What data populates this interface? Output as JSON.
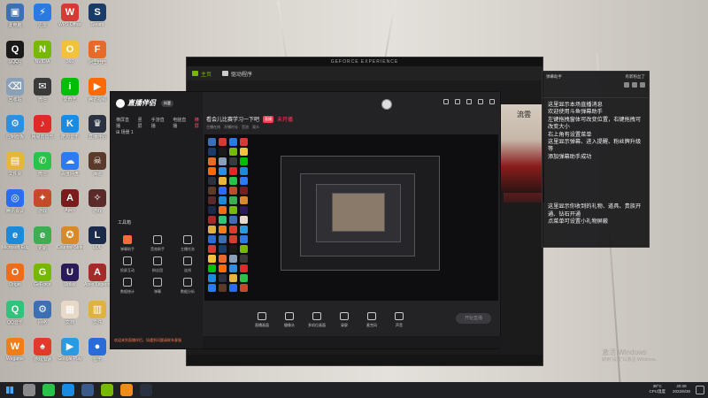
{
  "desktop": {
    "icons": [
      {
        "label": "此电脑",
        "glyph": "▣",
        "color": "#3d6fb3",
        "col": 0,
        "row": 0
      },
      {
        "label": "易语言",
        "glyph": "Y",
        "color": "#d53b2f",
        "col": 0,
        "row": 1
      },
      {
        "label": "迅雷",
        "glyph": "⚡",
        "color": "#2a7ae2",
        "col": 1,
        "row": 0
      },
      {
        "label": "WPS Office",
        "glyph": "W",
        "color": "#d43b34",
        "col": 2,
        "row": 0
      },
      {
        "label": "Steam",
        "glyph": "S",
        "color": "#1b3c6b",
        "col": 3,
        "row": 0
      },
      {
        "label": "QQ",
        "glyph": "Q",
        "color": "#1a1a1a",
        "col": 0,
        "row": 1
      },
      {
        "label": "NVIDIA",
        "glyph": "N",
        "color": "#76b900",
        "col": 1,
        "row": 1
      },
      {
        "label": "360",
        "glyph": "O",
        "color": "#f3c23b",
        "col": 2,
        "row": 1
      },
      {
        "label": "阿里旺旺",
        "glyph": "F",
        "color": "#e86a2b",
        "col": 3,
        "row": 1
      },
      {
        "label": "回收站",
        "glyph": "⌫",
        "color": "#8aa0b8",
        "col": 0,
        "row": 2
      },
      {
        "label": "微信",
        "glyph": "✉",
        "color": "#3a3a3a",
        "col": 1,
        "row": 2
      },
      {
        "label": "爱奇艺",
        "glyph": "i",
        "color": "#00be06",
        "col": 2,
        "row": 2
      },
      {
        "label": "腾讯视频",
        "glyph": "▶",
        "color": "#ff6a00",
        "col": 3,
        "row": 2
      },
      {
        "label": "控制面板",
        "glyph": "⚙",
        "color": "#2d8fe0",
        "col": 0,
        "row": 3
      },
      {
        "label": "网易云音乐",
        "glyph": "♪",
        "color": "#e02a2a",
        "col": 1,
        "row": 3
      },
      {
        "label": "酷狗音乐",
        "glyph": "K",
        "color": "#1a8be3",
        "col": 2,
        "row": 3
      },
      {
        "label": "直播伴侣",
        "glyph": "♛",
        "color": "#2a3140",
        "col": 3,
        "row": 3
      },
      {
        "label": "文件夹",
        "glyph": "▤",
        "color": "#e8b53b",
        "col": 0,
        "row": 4
      },
      {
        "label": "微信",
        "glyph": "✆",
        "color": "#2ac34a",
        "col": 1,
        "row": 4
      },
      {
        "label": "百度网盘",
        "glyph": "☁",
        "color": "#2d7bf3",
        "col": 2,
        "row": 4
      },
      {
        "label": "海盗",
        "glyph": "☠",
        "color": "#5a3a2a",
        "col": 3,
        "row": 4
      },
      {
        "label": "腾讯会议",
        "glyph": "◎",
        "color": "#2a6df4",
        "col": 0,
        "row": 5
      },
      {
        "label": "游戏",
        "glyph": "✦",
        "color": "#c54a2a",
        "col": 1,
        "row": 5
      },
      {
        "label": "Apex",
        "glyph": "A",
        "color": "#7a1c1c",
        "col": 2,
        "row": 5
      },
      {
        "label": "游戏",
        "glyph": "✧",
        "color": "#5a2a2a",
        "col": 3,
        "row": 5
      },
      {
        "label": "Microsoft Edge",
        "glyph": "e",
        "color": "#1d8ad9",
        "col": 0,
        "row": 6
      },
      {
        "label": "更新",
        "glyph": "e",
        "color": "#3fae52",
        "col": 1,
        "row": 6
      },
      {
        "label": "Counter-Strike",
        "glyph": "✪",
        "color": "#d88a2a",
        "col": 2,
        "row": 6
      },
      {
        "label": "LOL",
        "glyph": "L",
        "color": "#1a2a4a",
        "col": 3,
        "row": 6
      },
      {
        "label": "Origin",
        "glyph": "O",
        "color": "#ef6c1a",
        "col": 0,
        "row": 7
      },
      {
        "label": "GeForce",
        "glyph": "G",
        "color": "#76b900",
        "col": 1,
        "row": 7
      },
      {
        "label": "Uplay",
        "glyph": "U",
        "color": "#2a1a5a",
        "col": 2,
        "row": 7
      },
      {
        "label": "Apex Legends",
        "glyph": "A",
        "color": "#a52a2a",
        "col": 3,
        "row": 7
      },
      {
        "label": "QQ音乐",
        "glyph": "Q",
        "color": "#31c27c",
        "col": 0,
        "row": 8
      },
      {
        "label": "网络",
        "glyph": "⚙",
        "color": "#3d6fb3",
        "col": 1,
        "row": 8
      },
      {
        "label": "文档",
        "glyph": "▦",
        "color": "#e8d8c8",
        "col": 2,
        "row": 8
      },
      {
        "label": "文件",
        "glyph": "▥",
        "color": "#e0b040",
        "col": 3,
        "row": 8
      },
      {
        "label": "Wegame",
        "glyph": "W",
        "color": "#ef7d1a",
        "col": 0,
        "row": 9
      },
      {
        "label": "游戏加速",
        "glyph": "♠",
        "color": "#e23a2a",
        "col": 1,
        "row": 9
      },
      {
        "label": "Google Play",
        "glyph": "▶",
        "color": "#2a9ae2",
        "col": 2,
        "row": 9
      },
      {
        "label": "音乐",
        "glyph": "●",
        "color": "#2a6ad9",
        "col": 3,
        "row": 9
      }
    ]
  },
  "geforce": {
    "title": "GEFORCE EXPERIENCE",
    "tabs": [
      "主页",
      "驱动程序"
    ]
  },
  "zhibo": {
    "logo": "直播伴侣",
    "badge": "抖音",
    "subtabs": [
      "横屏直播",
      "竖屏",
      "手游直播",
      "电脑直播",
      "横屏"
    ],
    "scene": "场景 1",
    "tools_label": "工具箱",
    "tools": [
      {
        "label": "弹幕助手",
        "hot": true
      },
      {
        "label": "音效助手",
        "hot": false
      },
      {
        "label": "主播任务",
        "hot": false
      },
      {
        "label": "投屏互动",
        "hot": false
      },
      {
        "label": "粉丝团",
        "hot": false
      },
      {
        "label": "连线",
        "hot": false
      },
      {
        "label": "数据统计",
        "hot": false
      },
      {
        "label": "弹幕",
        "hot": false
      },
      {
        "label": "数据分析",
        "hot": false
      }
    ],
    "title": "看会儿比赛学习一下吧",
    "title_tag": "直播",
    "title_extra": "未开播",
    "sub_items": [
      "主播在线",
      "开播时长",
      "音浪",
      "观众"
    ],
    "bottom_buttons": [
      "直播画面",
      "摄像头",
      "多机位画面",
      "录屏",
      "麦克风",
      "声音"
    ],
    "start_label": "开始直播",
    "notice": "欢迎来到直播伴侣，如遇到问题请联系客服"
  },
  "chat": {
    "header_left": "弹幕助手",
    "header_right": "有新粉丝了",
    "lines": [
      "这里显示本场直播消息",
      "欢迎使用斗鱼弹幕助手",
      "左键拖拽窗体可改变位置，右键拖拽可改变大小",
      "右上角有设置菜单",
      "这里显示弹幕、进入提醒、粉丝牌升级等",
      "添加弹幕助手成功"
    ],
    "lines2": [
      "这里显示你收到的礼物、道具、贵族开通、钻石开通",
      "点菜单可设置小礼物屏蔽"
    ]
  },
  "watermark": {
    "line1": "激活 Windows",
    "line2": "转到\"设置\"以激活 Windows。"
  },
  "taskbar": {
    "apps": [
      "#8a8a8a",
      "#2ac34a",
      "#1a8be3",
      "#3a5a8a",
      "#76b900",
      "#ef8c1a",
      "#2a3140"
    ],
    "weather_temp": "38°C",
    "weather_label": "CPU温度",
    "time": "20:28",
    "date": "2022/6/30"
  }
}
